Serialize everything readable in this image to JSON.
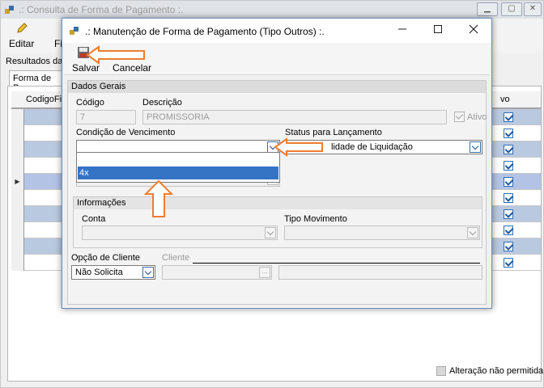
{
  "background_window": {
    "title": ".: Consulta de Forma de Pagamento :.",
    "toolbar": {
      "editar_label": "Editar",
      "truncated_label": "Fi"
    },
    "results_label": "Resultados da F",
    "tab_label": "Forma de Pag",
    "grid": {
      "columns": [
        "CodigoFin",
        "vo"
      ],
      "rows": [
        {
          "checked": true,
          "highlight": false,
          "current": false
        },
        {
          "checked": true,
          "highlight": false,
          "current": false
        },
        {
          "checked": true,
          "highlight": false,
          "current": false
        },
        {
          "checked": true,
          "highlight": false,
          "current": false
        },
        {
          "checked": true,
          "highlight": true,
          "current": true
        },
        {
          "checked": true,
          "highlight": false,
          "current": false
        },
        {
          "checked": true,
          "highlight": false,
          "current": false
        },
        {
          "checked": true,
          "highlight": false,
          "current": false
        },
        {
          "checked": true,
          "highlight": false,
          "current": false
        },
        {
          "checked": true,
          "highlight": false,
          "current": false
        }
      ]
    },
    "status_checkbox_label": "Alteração não permitida"
  },
  "dialog": {
    "title": ".: Manutenção de Forma de Pagamento (Tipo Outros) :.",
    "toolbar": {
      "salvar_label": "Salvar",
      "cancelar_label": "Cancelar"
    },
    "dados_gerais": {
      "header": "Dados Gerais",
      "codigo_label": "Código",
      "codigo_value": "7",
      "descricao_label": "Descrição",
      "descricao_value": "PROMISSORIA",
      "ativo_label": "Ativo",
      "ativo_checked": true,
      "condicao_label": "Condição de Vencimento",
      "condicao_value": "",
      "condicao_options": [
        "",
        "4x"
      ],
      "condicao_highlighted_option": "4x",
      "status_label": "Status para Lançamento",
      "status_value": "lidade de Liquidação"
    },
    "informacoes": {
      "header": "Informações",
      "conta_label": "Conta",
      "tipo_movimento_label": "Tipo Movimento"
    },
    "opcao_cliente_label": "Opção de Cliente",
    "opcao_cliente_value": "Não Solicita",
    "cliente_label": "Cliente",
    "ellipsis": "..."
  },
  "colors": {
    "selection_blue": "#3573c5",
    "grid_row_blue": "#b9c9e0",
    "annotation_arrow": "#ed7d31"
  }
}
